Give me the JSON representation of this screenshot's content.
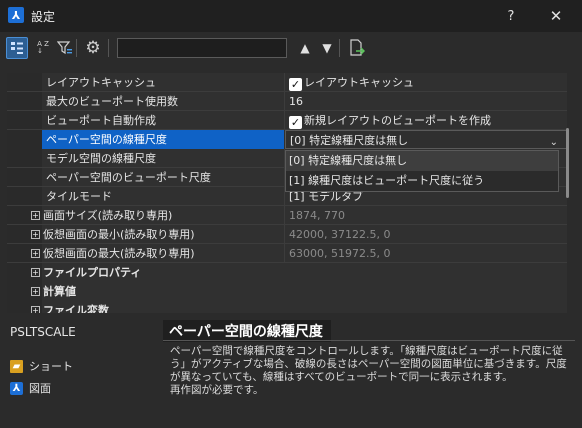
{
  "window": {
    "title": "設定",
    "help_label": "?",
    "close_label": "✕"
  },
  "toolbar": {
    "search": {
      "value": "",
      "placeholder": ""
    },
    "up_label": "🡅",
    "down_label": "🡇"
  },
  "grid": {
    "rows": [
      {
        "name": "レイアウトキャッシュ",
        "value": "レイアウトキャッシュ",
        "checkbox": true
      },
      {
        "name": "最大のビューポート使用数",
        "value": "16"
      },
      {
        "name": "ビューポート自動作成",
        "value": "新規レイアウトのビューポートを作成",
        "checkbox": true
      },
      {
        "name": "ペーパー空間の線種尺度",
        "value": "[0] 特定線種尺度は無し",
        "selected": true
      },
      {
        "name": "モデル空間の線種尺度",
        "value": ""
      },
      {
        "name": "ペーパー空間のビューポート尺度",
        "value": ""
      },
      {
        "name": "タイルモード",
        "value": "[1] モデルタブ"
      },
      {
        "name": "画面サイズ(読み取り専用)",
        "value": "1874, 770",
        "readonly": true,
        "expandable": true
      },
      {
        "name": "仮想画面の最小(読み取り専用)",
        "value": "42000, 37122.5, 0",
        "readonly": true,
        "expandable": true
      },
      {
        "name": "仮想画面の最大(読み取り専用)",
        "value": "63000, 51972.5, 0",
        "readonly": true,
        "expandable": true
      },
      {
        "name": "ファイルプロパティ",
        "category": true
      },
      {
        "name": "計算値",
        "category": true
      },
      {
        "name": "ファイル変数",
        "category": true
      }
    ],
    "dropdown_options": [
      "[0] 特定線種尺度は無し",
      "[1] 線種尺度はビューポート尺度に従う"
    ]
  },
  "description": {
    "variable": "PSLTSCALE",
    "links": [
      {
        "label": "ショート",
        "icon": "shortcut-folder-icon"
      },
      {
        "label": "図面",
        "icon": "drawing-app-icon"
      }
    ],
    "title": "ペーパー空間の線種尺度",
    "text": "ペーパー空間で線種尺度をコントロールします。「線種尺度はビューポート尺度に従う」がアクティブな場合、破線の長さはペーパー空間の図面単位に基づきます。尺度が異なっていても、線種はすべてのビューポートで同一に表示されます。\n再作図が必要です。"
  },
  "colors": {
    "accent": "#0f62c6",
    "background": "#2b2b2b",
    "readonly_text": "#8a8a8a"
  }
}
